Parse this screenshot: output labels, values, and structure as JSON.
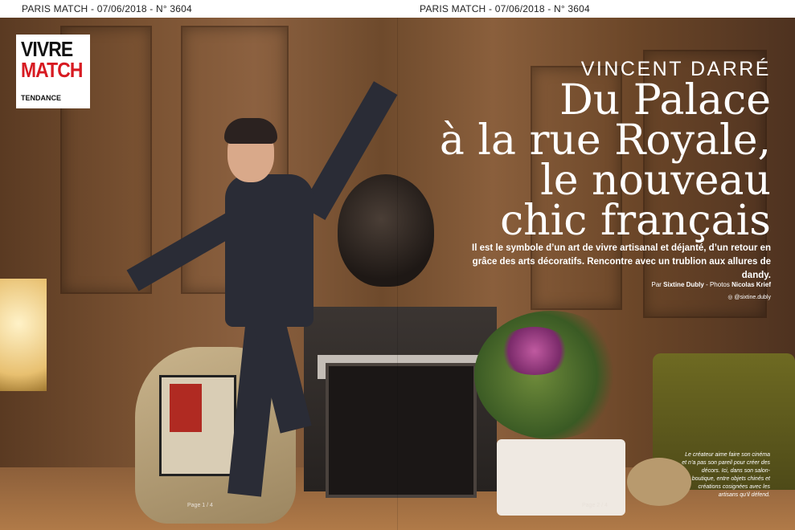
{
  "header": {
    "left": "PARIS MATCH - 07/06/2018 - N° 3604",
    "right": "PARIS MATCH - 07/06/2018 - N° 3604"
  },
  "logo": {
    "line1": "VIVRE",
    "line2": "MATCH",
    "line3": "TENDANCE"
  },
  "article": {
    "kicker": "VINCENT DARRÉ",
    "title_lines": [
      "Du Palace",
      "à la rue Royale,",
      "le nouveau",
      "chic français"
    ],
    "lede": "Il est le symbole d’un art de vivre artisanal et déjanté, d’un retour en grâce des arts décoratifs. Rencontre avec un trublion aux allures de dandy.",
    "byline_prefix": "Par ",
    "author": "Sixtine Dubly",
    "byline_mid": " - Photos ",
    "photographer": "Nicolas Krief",
    "instagram": "◎ @sixtine.dubly",
    "caption": "Le créateur aime faire son cinéma et n’a pas son pareil pour créer des décors. Ici, dans son salon-boutique, entre objets chinés et créations cosignées avec les artisans qu’il défend."
  },
  "pages": {
    "left": "Page 1 / 4",
    "right": "Page 2 / 4"
  },
  "colors": {
    "accent_red": "#d71a21",
    "wood": "#7a5232"
  }
}
